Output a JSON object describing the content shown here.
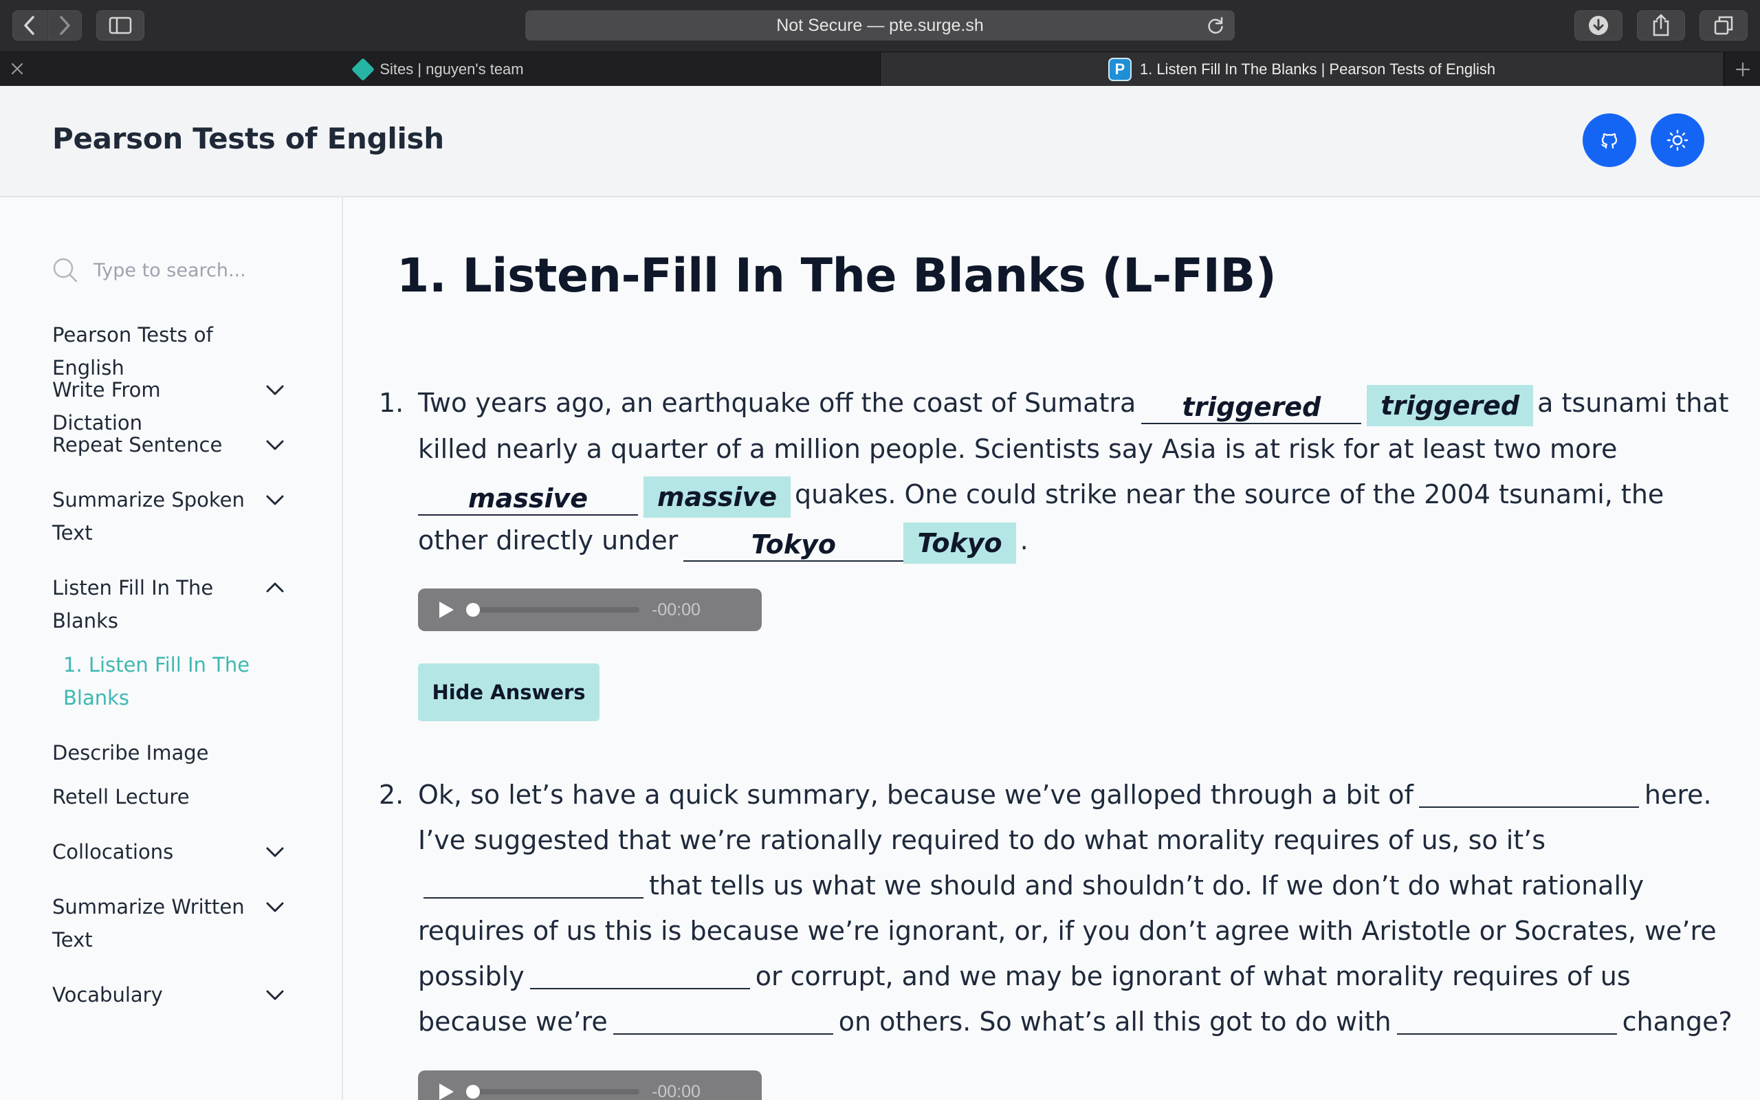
{
  "browser": {
    "address": "Not Secure — pte.surge.sh",
    "tabs": [
      {
        "label": "Sites | nguyen's team"
      },
      {
        "label": "1. Listen Fill In The Blanks | Pearson Tests of English"
      }
    ]
  },
  "header": {
    "title": "Pearson Tests of English"
  },
  "sidebar": {
    "search_placeholder": "Type to search...",
    "items": [
      {
        "label": "Pearson Tests of English"
      },
      {
        "label": "Write From Dictation"
      },
      {
        "label": "Repeat Sentence"
      },
      {
        "label": "Summarize Spoken Text"
      },
      {
        "label": "Listen Fill In The Blanks"
      },
      {
        "label": "1. Listen Fill In The Blanks"
      },
      {
        "label": "Describe Image"
      },
      {
        "label": "Retell Lecture"
      },
      {
        "label": "Collocations"
      },
      {
        "label": "Summarize Written Text"
      },
      {
        "label": "Vocabulary"
      }
    ]
  },
  "main": {
    "title": "1. Listen-Fill In The Blanks (L-FIB)",
    "q1": {
      "num": "1.",
      "t1": "Two years ago, an earthquake off the coast of Sumatra",
      "b1": "triggered",
      "a1": "triggered",
      "t2": "a tsunami that killed nearly a quarter of a million people. Scientists say Asia is at risk for at least two more",
      "b2": "massive",
      "a2": "massive",
      "t3": "quakes. One could strike near the source of the 2004 tsunami, the other directly under",
      "b3": "Tokyo",
      "a3": "Tokyo",
      "t4": "."
    },
    "audio_time": "-00:00",
    "hide_answers": "Hide Answers",
    "q2": {
      "num": "2.",
      "t1": "Ok, so let’s have a quick summary, because we’ve galloped through a bit of",
      "t2": "here. I’ve suggested that we’re rationally required to do what morality requires of us, so it’s",
      "t3": "that tells us what we should and shouldn’t do. If we don’t do what rationally requires of us this is because we’re ignorant, or, if you don’t agree with Aristotle or Socrates, we’re possibly",
      "t4": "or corrupt, and we may be ignorant of what morality requires of us because we’re",
      "t5": "on others. So what’s all this got to do with",
      "t6": "change?"
    }
  }
}
